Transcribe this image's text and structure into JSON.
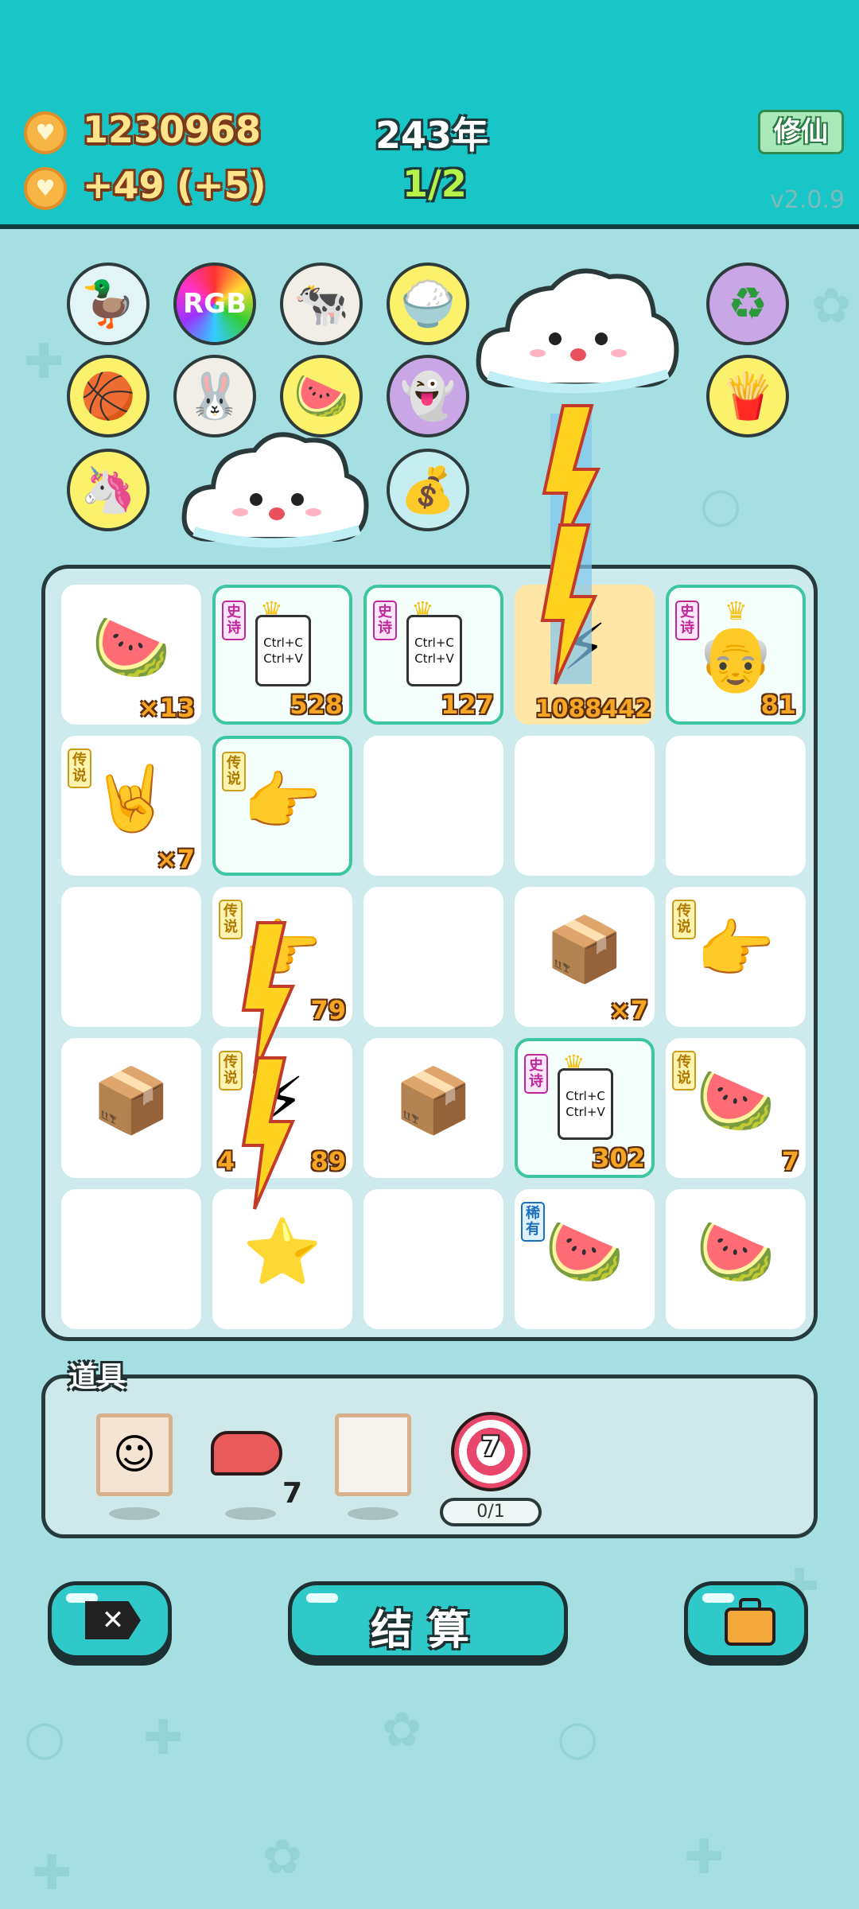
{
  "header": {
    "coins": "1230968",
    "income": "+49",
    "income_bonus": "(+5)",
    "year": "243年",
    "round": "1/2",
    "cultivate_button": "修仙",
    "version": "v2.0.9"
  },
  "symbols": [
    {
      "name": "duck-pot",
      "icon": "🦆"
    },
    {
      "name": "rgb",
      "icon": "RGB"
    },
    {
      "name": "cows",
      "icon": "🐄"
    },
    {
      "name": "rice",
      "icon": "🍚"
    },
    {
      "name": "recycle",
      "icon": "♻"
    },
    {
      "name": "basketballs",
      "icon": "🏀"
    },
    {
      "name": "rabbit",
      "icon": "🐰"
    },
    {
      "name": "fruit-basket",
      "icon": "🍉"
    },
    {
      "name": "ghost",
      "icon": "👻"
    },
    {
      "name": "fries",
      "icon": "🍟"
    },
    {
      "name": "unicorn",
      "icon": "🦄"
    },
    {
      "name": "money-bag",
      "icon": "💰"
    }
  ],
  "board": {
    "cells": [
      {
        "icon": "🍉",
        "count": "×13",
        "tag": "",
        "type": "plain"
      },
      {
        "icon": "",
        "count": "528",
        "tag": "史诗",
        "type": "copy",
        "line1": "Ctrl+C",
        "line2": "Ctrl+V"
      },
      {
        "icon": "",
        "count": "127",
        "tag": "史诗",
        "type": "copy",
        "line1": "Ctrl+C",
        "line2": "Ctrl+V"
      },
      {
        "icon": "⚡",
        "count": "1088442",
        "tag": "",
        "type": "plain"
      },
      {
        "icon": "👴",
        "count": "81",
        "tag": "史诗",
        "type": "king"
      },
      {
        "icon": "🤘",
        "count": "×7",
        "tag": "传说",
        "type": "plain"
      },
      {
        "icon": "👉",
        "count": "",
        "tag": "传说",
        "type": "hl"
      },
      {
        "icon": "",
        "count": "",
        "tag": "",
        "type": "plain"
      },
      {
        "icon": "",
        "count": "",
        "tag": "",
        "type": "plain"
      },
      {
        "icon": "",
        "count": "",
        "tag": "",
        "type": "plain"
      },
      {
        "icon": "",
        "count": "",
        "tag": "",
        "type": "plain"
      },
      {
        "icon": "👉",
        "count": "79",
        "tag": "传说",
        "type": "plain"
      },
      {
        "icon": "",
        "count": "",
        "tag": "",
        "type": "plain"
      },
      {
        "icon": "📦",
        "count": "×7",
        "tag": "",
        "type": "plain"
      },
      {
        "icon": "👉",
        "count": "",
        "tag": "传说",
        "type": "plain"
      },
      {
        "icon": "📦",
        "count": "",
        "tag": "",
        "type": "plain"
      },
      {
        "icon": "⚡",
        "count": "89",
        "tag": "传说",
        "type": "plain",
        "left_count": "4"
      },
      {
        "icon": "📦",
        "count": "",
        "tag": "",
        "type": "plain"
      },
      {
        "icon": "",
        "count": "302",
        "tag": "史诗",
        "type": "copy",
        "line1": "Ctrl+C",
        "line2": "Ctrl+V"
      },
      {
        "icon": "🍉",
        "count": "7",
        "tag": "传说",
        "type": "plain"
      },
      {
        "icon": "",
        "count": "",
        "tag": "",
        "type": "plain"
      },
      {
        "icon": "⭐",
        "count": "",
        "tag": "",
        "type": "plain"
      },
      {
        "icon": "",
        "count": "",
        "tag": "",
        "type": "plain"
      },
      {
        "icon": "🍉",
        "count": "",
        "tag": "稀有",
        "type": "plain"
      },
      {
        "icon": "🍉",
        "count": "",
        "tag": "",
        "type": "plain"
      }
    ]
  },
  "items": {
    "title": "道具",
    "liver_count": "7",
    "target_number": "7",
    "target_progress": "0/1"
  },
  "buttons": {
    "settle_label": "结算"
  },
  "colors": {
    "header": "#18c6c7",
    "background": "#a6dfe2",
    "accent": "#2fc9ca"
  }
}
